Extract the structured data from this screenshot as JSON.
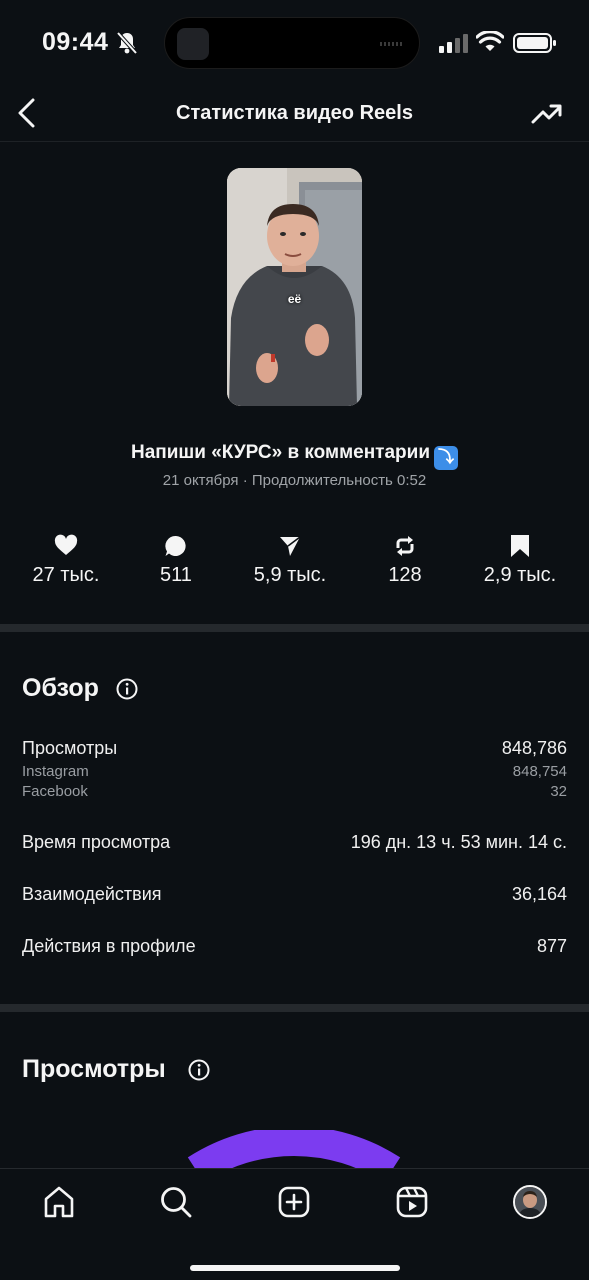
{
  "status_bar": {
    "time": "09:44",
    "icons": [
      "bell-slash-icon",
      "signal-icon",
      "wifi-icon",
      "battery-icon"
    ]
  },
  "header": {
    "title": "Статистика видео Reels",
    "back_icon": "chevron-left-icon",
    "right_icon": "trending-up-icon"
  },
  "reel": {
    "thumbnail_caption": "её",
    "title": "Напиши «КУРС» в комментарии",
    "title_emoji": "⤵",
    "meta": "21 октября · Продолжительность 0:52"
  },
  "metrics": [
    {
      "icon": "heart-icon",
      "value": "27 тыс."
    },
    {
      "icon": "comment-icon",
      "value": "511"
    },
    {
      "icon": "send-icon",
      "value": "5,9 тыс."
    },
    {
      "icon": "repost-icon",
      "value": "128"
    },
    {
      "icon": "bookmark-icon",
      "value": "2,9 тыс."
    }
  ],
  "overview": {
    "title": "Обзор",
    "views_label": "Просмотры",
    "views_value": "848,786",
    "instagram_label": "Instagram",
    "instagram_value": "848,754",
    "facebook_label": "Facebook",
    "facebook_value": "32",
    "watch_time_label": "Время просмотра",
    "watch_time_value": "196 дн. 13 ч. 53 мин. 14 с.",
    "interactions_label": "Взаимодействия",
    "interactions_value": "36,164",
    "profile_actions_label": "Действия в профиле",
    "profile_actions_value": "877"
  },
  "views_section": {
    "title": "Просмотры"
  },
  "colors": {
    "background": "#0c1014",
    "accent": "#7c3cf0"
  },
  "bottom_nav": {
    "items": [
      "home-icon",
      "search-icon",
      "create-icon",
      "reels-icon",
      "profile-avatar"
    ]
  }
}
